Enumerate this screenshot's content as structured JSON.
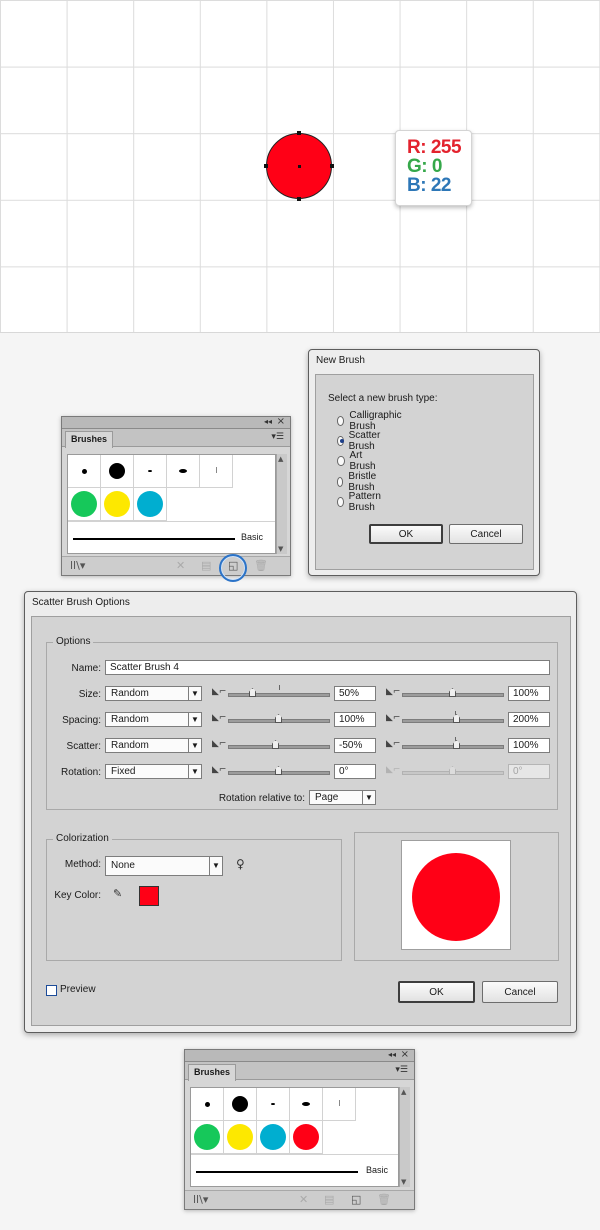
{
  "colors": {
    "red": "#ff0016",
    "green": "#16c85a",
    "yellow": "#fde800",
    "cyan": "#00aed0",
    "readout_r": "#e3222d",
    "readout_g": "#35a84a",
    "readout_b": "#2d77b7"
  },
  "color_readout": {
    "r": "R: 255",
    "g": "G: 0",
    "b": "B: 22"
  },
  "brushes_panel_1": {
    "tab": "Brushes",
    "basic_label": "Basic"
  },
  "new_brush_dialog": {
    "title": "New Brush",
    "prompt": "Select a new brush type:",
    "options": [
      {
        "label": "Calligraphic Brush",
        "selected": false
      },
      {
        "label": "Scatter Brush",
        "selected": true
      },
      {
        "label": "Art Brush",
        "selected": false
      },
      {
        "label": "Bristle Brush",
        "selected": false
      },
      {
        "label": "Pattern Brush",
        "selected": false
      }
    ],
    "ok": "OK",
    "cancel": "Cancel"
  },
  "scatter_dialog": {
    "title": "Scatter Brush Options",
    "options_legend": "Options",
    "name_label": "Name:",
    "name_value": "Scatter Brush 4",
    "rows": [
      {
        "label": "Size:",
        "mode": "Random",
        "min": "50%",
        "max": "100%",
        "min_pos": 0.24,
        "max_pos": 0.5
      },
      {
        "label": "Spacing:",
        "mode": "Random",
        "min": "100%",
        "max": "200%",
        "min_pos": 0.5,
        "max_pos": 0.54
      },
      {
        "label": "Scatter:",
        "mode": "Random",
        "min": "-50%",
        "max": "100%",
        "min_pos": 0.47,
        "max_pos": 0.54
      },
      {
        "label": "Rotation:",
        "mode": "Fixed",
        "min": "0°",
        "max": "0°",
        "min_pos": 0.5,
        "max_pos": 0.5
      }
    ],
    "rotation_relative_label": "Rotation relative to:",
    "rotation_relative_value": "Page",
    "colorization_legend": "Colorization",
    "method_label": "Method:",
    "method_value": "None",
    "key_color_label": "Key Color:",
    "preview_label": "Preview",
    "ok": "OK",
    "cancel": "Cancel"
  },
  "brushes_panel_2": {
    "tab": "Brushes",
    "basic_label": "Basic"
  }
}
